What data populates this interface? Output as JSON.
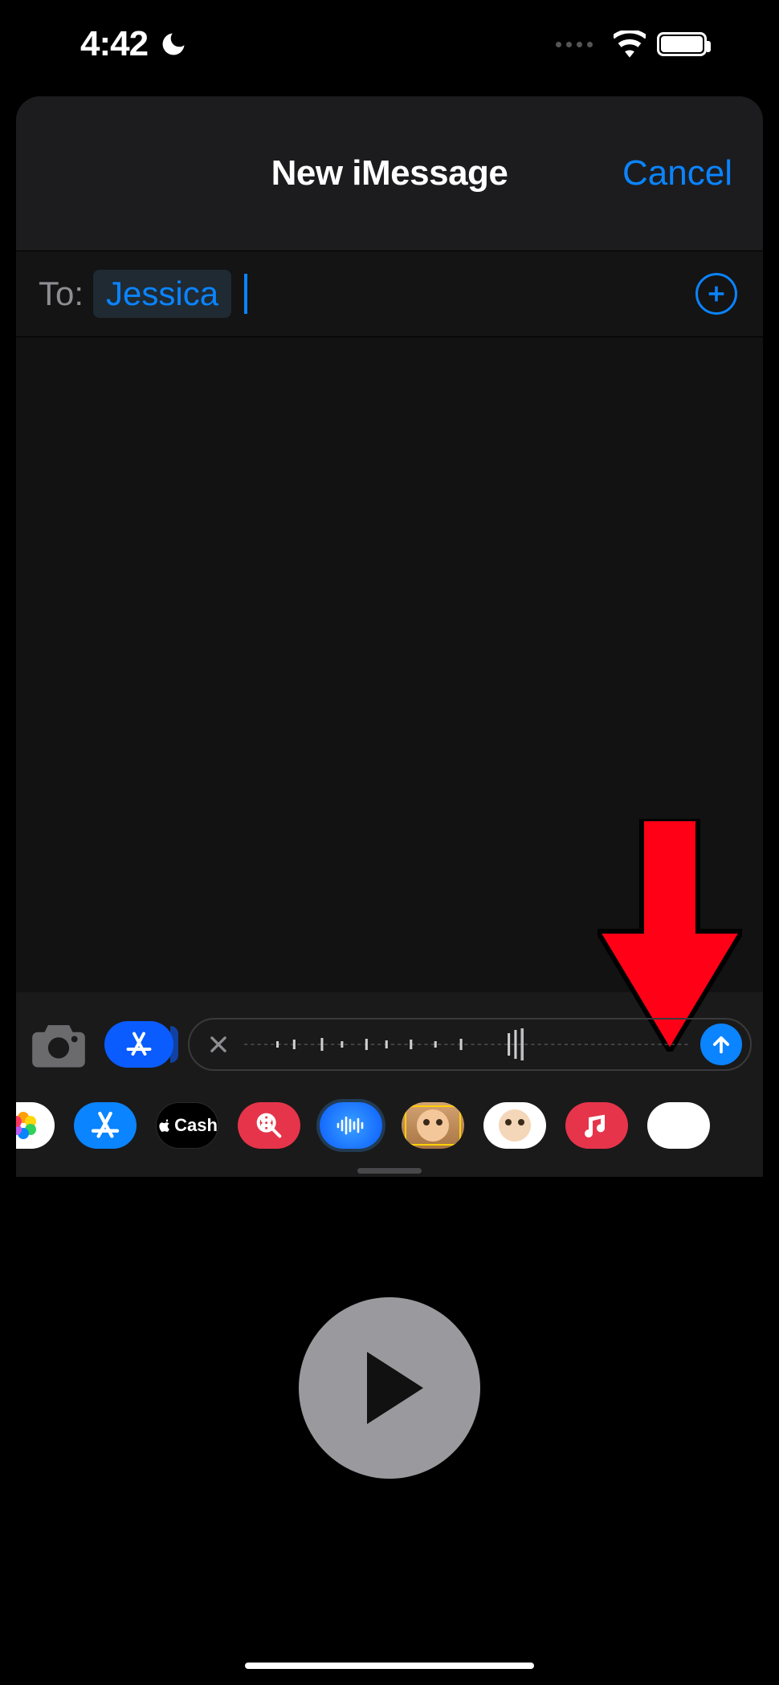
{
  "status": {
    "time": "4:42"
  },
  "header": {
    "title": "New iMessage",
    "cancel": "Cancel"
  },
  "compose": {
    "to_label": "To:",
    "recipient": "Jessica"
  },
  "apps": {
    "cash_label": "Cash"
  },
  "colors": {
    "accent": "#0a84ff",
    "annotation": "#ff0016"
  }
}
